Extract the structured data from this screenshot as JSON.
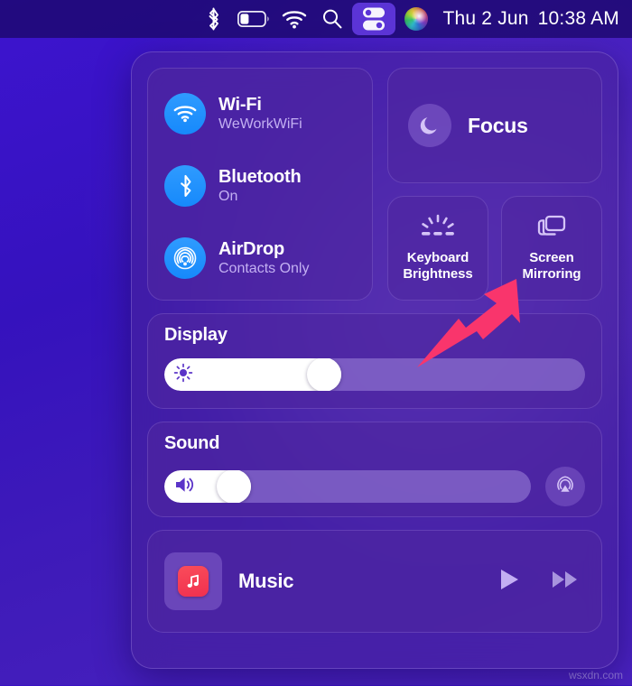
{
  "menubar": {
    "icons": [
      {
        "name": "bluetooth-icon",
        "label": "Bluetooth"
      },
      {
        "name": "battery-icon",
        "label": "Battery"
      },
      {
        "name": "wifi-icon",
        "label": "Wi-Fi"
      },
      {
        "name": "search-icon",
        "label": "Spotlight Search"
      },
      {
        "name": "control-center-icon",
        "label": "Control Center"
      },
      {
        "name": "siri-icon",
        "label": "Siri"
      }
    ],
    "date": "Thu 2 Jun",
    "time": "10:38 AM"
  },
  "control_center": {
    "connectivity": [
      {
        "icon": "wifi-icon",
        "title": "Wi-Fi",
        "subtitle": "WeWorkWiFi"
      },
      {
        "icon": "bluetooth-icon",
        "title": "Bluetooth",
        "subtitle": "On"
      },
      {
        "icon": "airdrop-icon",
        "title": "AirDrop",
        "subtitle": "Contacts Only"
      }
    ],
    "focus": {
      "icon": "moon-icon",
      "label": "Focus"
    },
    "tiles": [
      {
        "icon": "keyboard-brightness-icon",
        "label_line1": "Keyboard",
        "label_line2": "Brightness"
      },
      {
        "icon": "screen-mirroring-icon",
        "label_line1": "Screen",
        "label_line2": "Mirroring"
      }
    ],
    "display": {
      "title": "Display",
      "icon": "brightness-icon",
      "value_percent": 38
    },
    "sound": {
      "title": "Sound",
      "icon": "speaker-icon",
      "value_percent": 19,
      "output_button_icon": "airplay-audio-icon"
    },
    "music": {
      "app_icon": "music-note-icon",
      "title": "Music",
      "controls": [
        {
          "name": "play-button",
          "icon": "play-icon"
        },
        {
          "name": "next-button",
          "icon": "fast-forward-icon"
        }
      ]
    }
  },
  "annotation": {
    "arrow_color": "#f9356c",
    "points_to": "screen-mirroring-tile"
  },
  "watermark": "wsxdn.com",
  "colors": {
    "accent_blue": "#1b8dfb",
    "panel_purple": "#4d26a0",
    "desktop_purple": "#3a12c4",
    "text_primary": "#ffffff",
    "text_secondary": "#c3b0f2",
    "music_red": "#f0304f"
  }
}
